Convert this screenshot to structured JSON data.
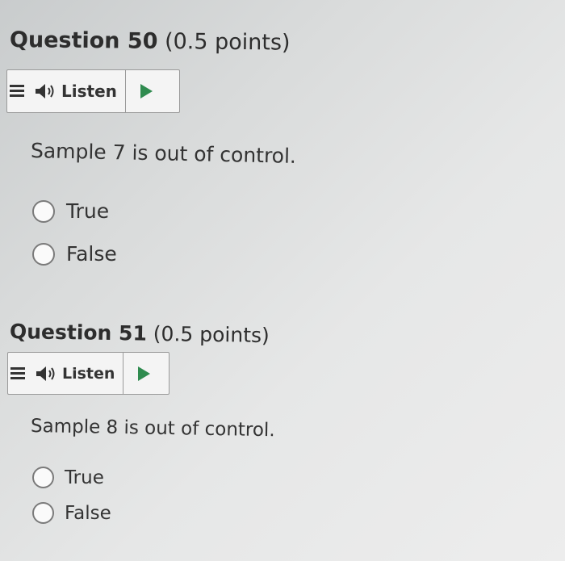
{
  "questions": [
    {
      "number_label": "Question 50",
      "points_label": "(0.5 points)",
      "listen_label": "Listen",
      "prompt": "Sample 7 is out of control.",
      "options": [
        "True",
        "False"
      ]
    },
    {
      "number_label": "Question 51",
      "points_label": "(0.5 points)",
      "listen_label": "Listen",
      "prompt": "Sample 8 is out of control.",
      "options": [
        "True",
        "False"
      ]
    }
  ],
  "icons": {
    "menu": "menu-icon",
    "speaker": "speaker-icon",
    "play": "play-icon",
    "play_color": "#2f8b4f"
  }
}
